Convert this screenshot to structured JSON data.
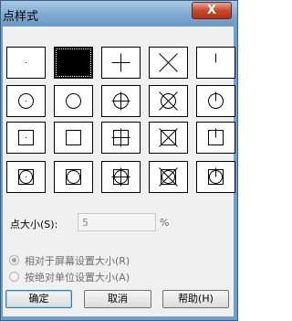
{
  "window": {
    "title": "点样式",
    "close_label": "X"
  },
  "point_styles": [
    [
      "dot",
      "none",
      "plus",
      "cross",
      "tick"
    ],
    [
      "circle-dot",
      "circle",
      "circle-plus",
      "circle-cross",
      "circle-tick"
    ],
    [
      "square-dot",
      "square",
      "square-plus",
      "square-cross",
      "square-tick"
    ],
    [
      "square-circle-dot",
      "square-circle",
      "square-circle-plus",
      "square-circle-cross",
      "square-circle-tick"
    ]
  ],
  "selected_style": "none",
  "point_size": {
    "label": "点大小(S):",
    "value": "5",
    "unit": "%"
  },
  "size_mode": {
    "options": [
      "相对于屏幕设置大小(R)",
      "按绝对单位设置大小(A)"
    ],
    "selected": "相对于屏幕设置大小(R)"
  },
  "buttons": {
    "ok": "确定",
    "cancel": "取消",
    "help": "帮助(H)"
  }
}
